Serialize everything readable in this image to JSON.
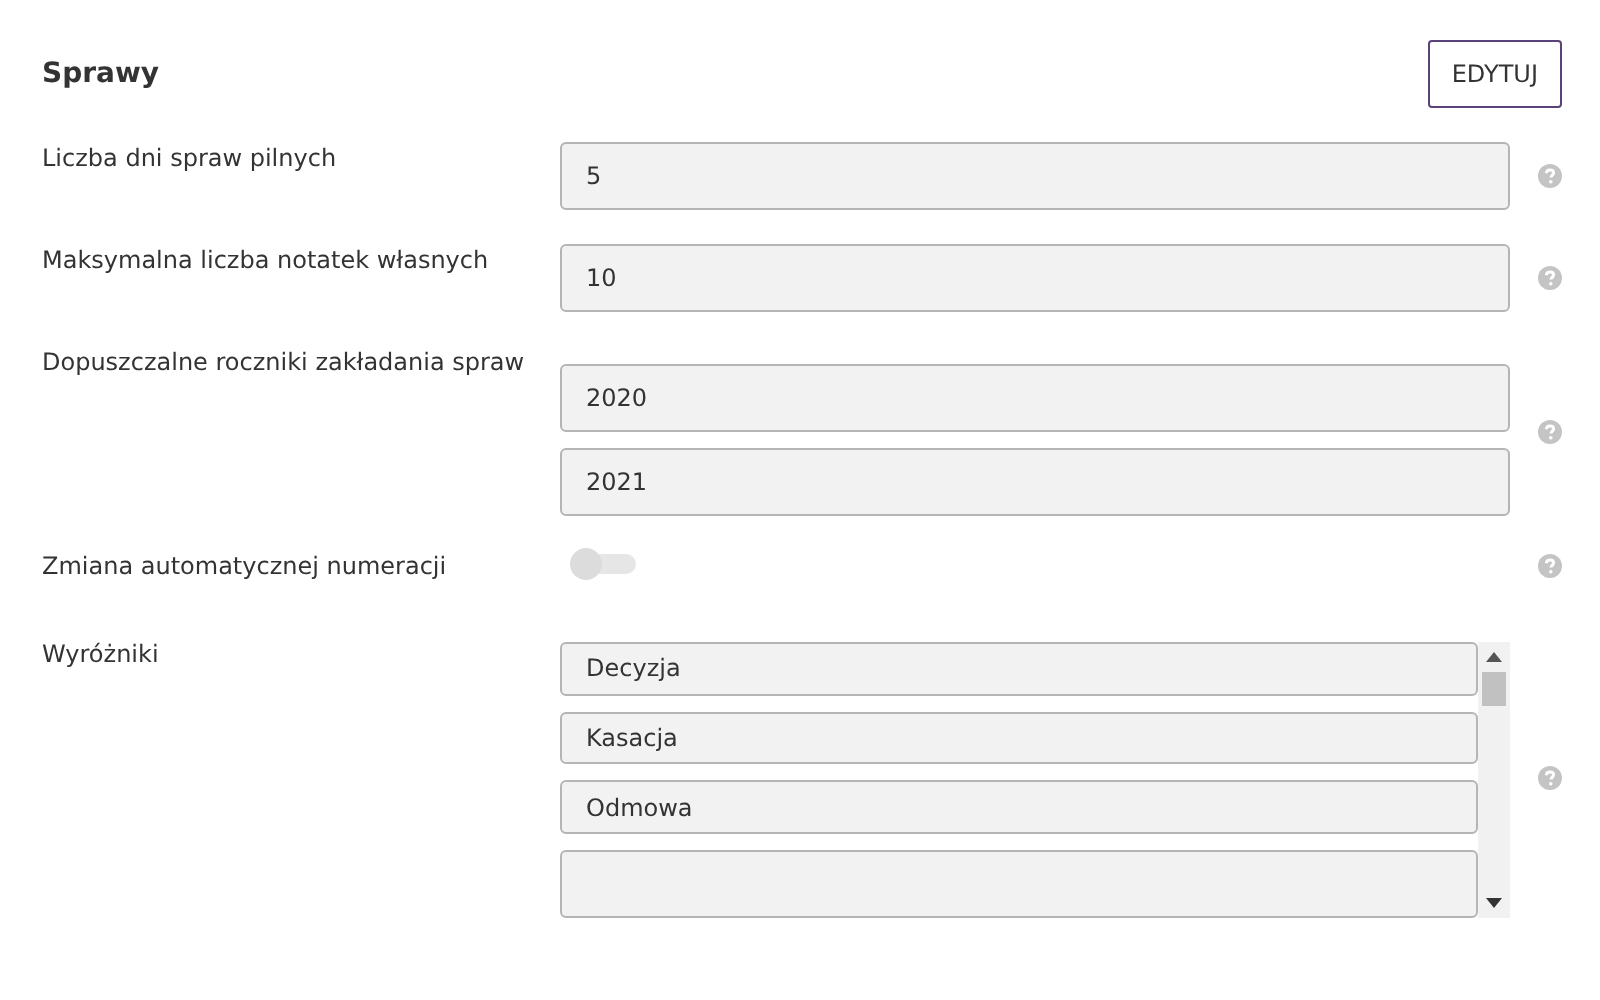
{
  "section": {
    "title": "Sprawy",
    "edit_button": "EDYTUJ"
  },
  "settings": [
    {
      "kind": "fields",
      "label": "Liczba dni spraw pilnych",
      "values": [
        "5"
      ]
    },
    {
      "kind": "fields",
      "label": "Maksymalna liczba notatek własnych",
      "values": [
        "10"
      ]
    },
    {
      "kind": "fields",
      "label": "Dopuszczalne roczniki zakładania spraw",
      "values": [
        "2020",
        "2021"
      ]
    },
    {
      "kind": "toggle",
      "label": "Zmiana automatycznej numeracji",
      "on": false
    },
    {
      "kind": "list",
      "label": "Wyróżniki",
      "items": [
        {
          "kind": "field",
          "value": "Decyzja"
        },
        {
          "kind": "field",
          "value": "Kasacja"
        },
        {
          "kind": "field",
          "value": "Odmowa"
        },
        {
          "kind": "cut"
        }
      ]
    }
  ]
}
